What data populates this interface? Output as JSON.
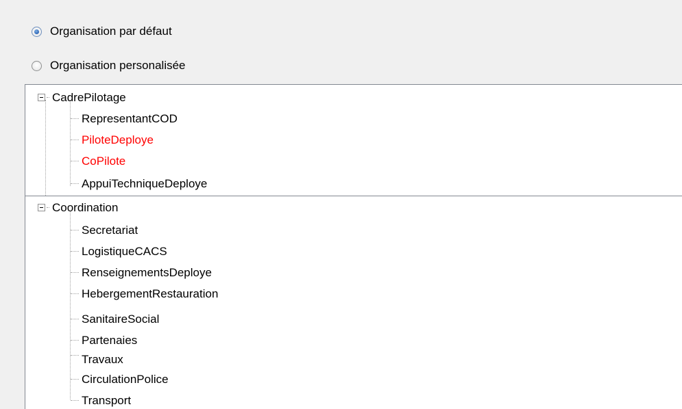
{
  "radios": [
    {
      "label": "Organisation par défaut",
      "checked": true
    },
    {
      "label": "Organisation personalisée",
      "checked": false
    }
  ],
  "tree_top": {
    "parent": "CadrePilotage",
    "children": [
      {
        "label": "RepresentantCOD",
        "color": "#000000"
      },
      {
        "label": "PiloteDeploye",
        "color": "#ff0000"
      },
      {
        "label": "CoPilote",
        "color": "#ff0000"
      },
      {
        "label": "AppuiTechniqueDeploye",
        "color": "#000000"
      }
    ]
  },
  "tree_bottom": {
    "parent": "Coordination",
    "children": [
      {
        "label": "Secretariat"
      },
      {
        "label": "LogistiqueCACS"
      },
      {
        "label": "RenseignementsDeploye"
      },
      {
        "label": "HebergementRestauration"
      },
      {
        "label": "SanitaireSocial"
      },
      {
        "label": "Partenaies"
      },
      {
        "label": "Travaux"
      },
      {
        "label": "CirculationPolice"
      },
      {
        "label": "Transport"
      }
    ]
  }
}
